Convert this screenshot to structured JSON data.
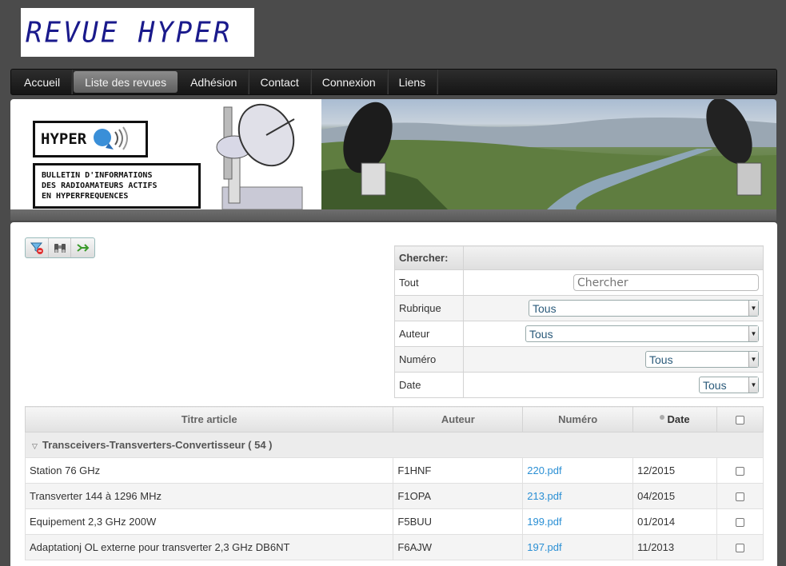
{
  "site": {
    "logo_text": "REVUE HYPER"
  },
  "nav": {
    "items": [
      "Accueil",
      "Liste des revues",
      "Adhésion",
      "Contact",
      "Connexion",
      "Liens"
    ],
    "active_index": 1
  },
  "banner": {
    "hyper_label": "HYPER",
    "bulletin_lines": [
      "BULLETIN D'INFORMATIONS",
      "DES RADIOAMATEURS ACTIFS",
      "EN HYPERFREQUENCES"
    ]
  },
  "toolbar": {
    "buttons": [
      {
        "icon": "filter-clear-icon"
      },
      {
        "icon": "binoculars-icon"
      },
      {
        "icon": "export-arrow-icon"
      }
    ]
  },
  "search": {
    "header": "Chercher:",
    "rows": [
      {
        "label": "Tout",
        "placeholder": "Chercher"
      },
      {
        "label": "Rubrique",
        "value": "Tous"
      },
      {
        "label": "Auteur",
        "value": "Tous"
      },
      {
        "label": "Numéro",
        "value": "Tous"
      },
      {
        "label": "Date",
        "value": "Tous"
      }
    ]
  },
  "grid": {
    "columns": [
      "Titre article",
      "Auteur",
      "Numéro",
      "Date"
    ],
    "group": {
      "label": "Transceivers-Transverters-Convertisseur ( 54 )"
    },
    "rows": [
      {
        "title": "Station 76 GHz",
        "author": "F1HNF",
        "number": "220.pdf",
        "date": "12/2015"
      },
      {
        "title": "Transverter 144 à 1296 MHz",
        "author": "F1OPA",
        "number": "213.pdf",
        "date": "04/2015"
      },
      {
        "title": "Equipement 2,3 GHz 200W",
        "author": "F5BUU",
        "number": "199.pdf",
        "date": "01/2014"
      },
      {
        "title": "Adaptationj OL externe pour transverter 2,3 GHz DB6NT",
        "author": "F6AJW",
        "number": "197.pdf",
        "date": "11/2013"
      }
    ]
  }
}
